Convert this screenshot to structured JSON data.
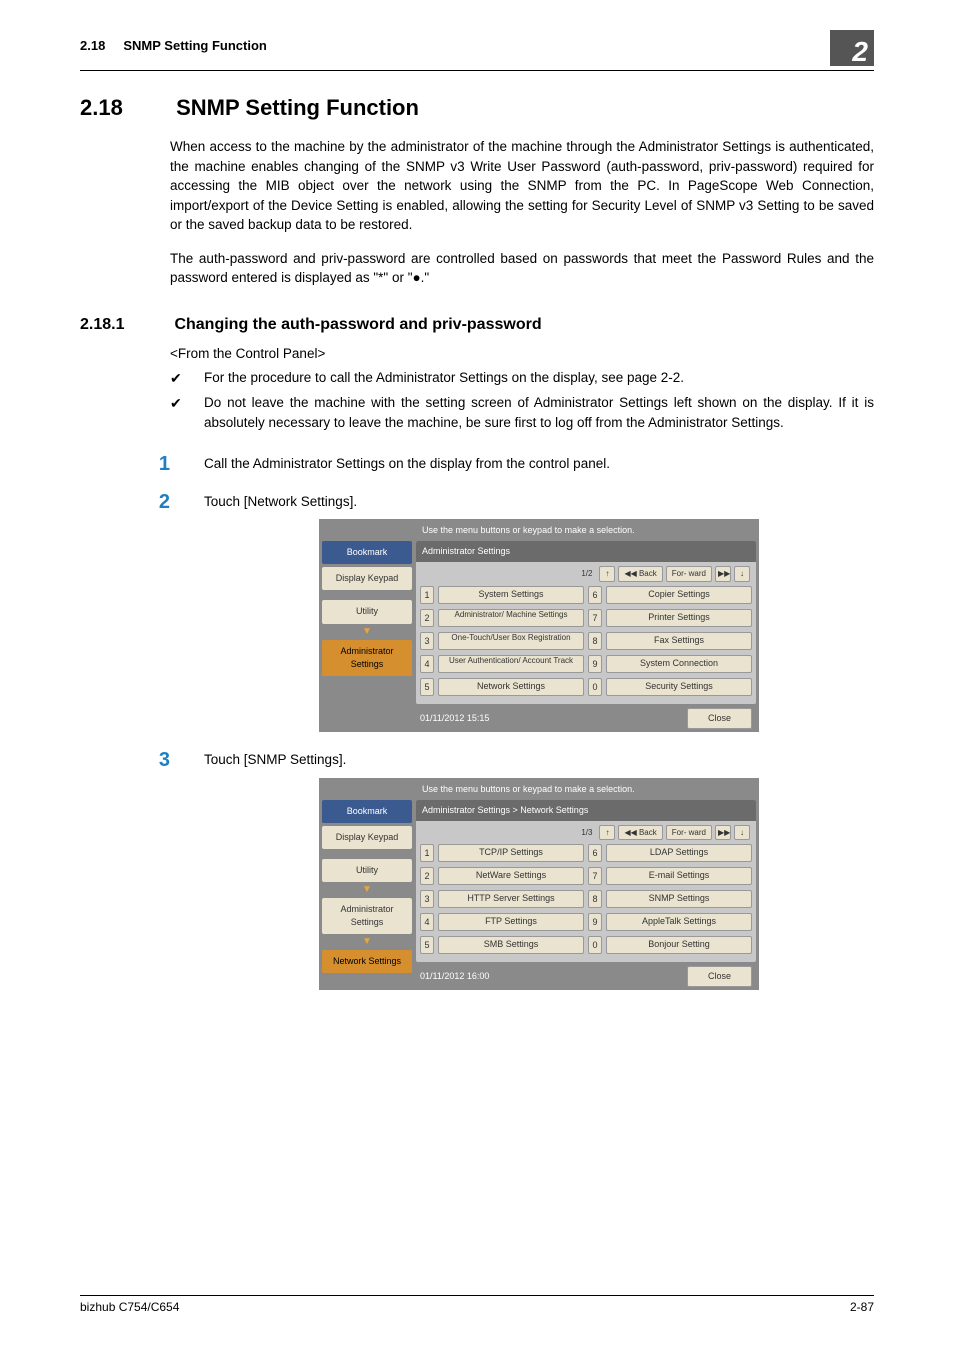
{
  "header": {
    "section_number_ref": "2.18",
    "section_name_ref": "SNMP Setting Function",
    "chapter_tab": "2"
  },
  "title": {
    "number": "2.18",
    "text": "SNMP Setting Function"
  },
  "intro_para_1": "When access to the machine by the administrator of the machine through the Administrator Settings is authenticated, the machine enables changing of the SNMP v3 Write User Password (auth-password, priv-password) required for accessing the MIB object over the network using the SNMP from the PC. In PageScope Web Connection, import/export of the Device Setting is enabled, allowing the setting for Security Level of SNMP v3 Setting to be saved or the saved backup data to be restored.",
  "intro_para_2": "The auth-password and priv-password are controlled based on passwords that meet the Password Rules and the password entered is displayed as \"*\" or \"●.\"",
  "subsection": {
    "number": "2.18.1",
    "text": "Changing the auth-password and priv-password"
  },
  "from_label": "<From the Control Panel>",
  "check_items": [
    "For the procedure to call the Administrator Settings on the display, see page 2-2.",
    "Do not leave the machine with the setting screen of Administrator Settings left shown on the display. If it is absolutely necessary to leave the machine, be sure first to log off from the Administrator Settings."
  ],
  "steps": [
    "Call the Administrator Settings on the display from the control panel.",
    "Touch [Network Settings].",
    "Touch [SNMP Settings]."
  ],
  "panel1": {
    "instruction": "Use the menu buttons or keypad to make a selection.",
    "side": {
      "bookmark": "Bookmark",
      "keypad": "Display Keypad",
      "utility": "Utility",
      "admin": "Administrator Settings"
    },
    "crumb": "Administrator Settings",
    "page": "1/2",
    "back": "Back",
    "fwd": "For-\nward",
    "items_left": [
      {
        "n": "1",
        "label": "System Settings"
      },
      {
        "n": "2",
        "label": "Administrator/\nMachine Settings"
      },
      {
        "n": "3",
        "label": "One-Touch/User Box\nRegistration"
      },
      {
        "n": "4",
        "label": "User Authentication/\nAccount Track"
      },
      {
        "n": "5",
        "label": "Network Settings"
      }
    ],
    "items_right": [
      {
        "n": "6",
        "label": "Copier Settings"
      },
      {
        "n": "7",
        "label": "Printer Settings"
      },
      {
        "n": "8",
        "label": "Fax Settings"
      },
      {
        "n": "9",
        "label": "System Connection"
      },
      {
        "n": "0",
        "label": "Security Settings"
      }
    ],
    "datetime": "01/11/2012   15:15",
    "close": "Close"
  },
  "panel2": {
    "instruction": "Use the menu buttons or keypad to make a selection.",
    "side": {
      "bookmark": "Bookmark",
      "keypad": "Display Keypad",
      "utility": "Utility",
      "admin": "Administrator Settings",
      "network": "Network Settings"
    },
    "crumb": "Administrator Settings > Network Settings",
    "page": "1/3",
    "back": "Back",
    "fwd": "For-\nward",
    "items_left": [
      {
        "n": "1",
        "label": "TCP/IP Settings"
      },
      {
        "n": "2",
        "label": "NetWare Settings"
      },
      {
        "n": "3",
        "label": "HTTP Server Settings"
      },
      {
        "n": "4",
        "label": "FTP Settings"
      },
      {
        "n": "5",
        "label": "SMB Settings"
      }
    ],
    "items_right": [
      {
        "n": "6",
        "label": "LDAP Settings"
      },
      {
        "n": "7",
        "label": "E-mail Settings"
      },
      {
        "n": "8",
        "label": "SNMP Settings"
      },
      {
        "n": "9",
        "label": "AppleTalk Settings"
      },
      {
        "n": "0",
        "label": "Bonjour Setting"
      }
    ],
    "datetime": "01/11/2012   16:00",
    "close": "Close"
  },
  "footer": {
    "product": "bizhub C754/C654",
    "page": "2-87"
  }
}
